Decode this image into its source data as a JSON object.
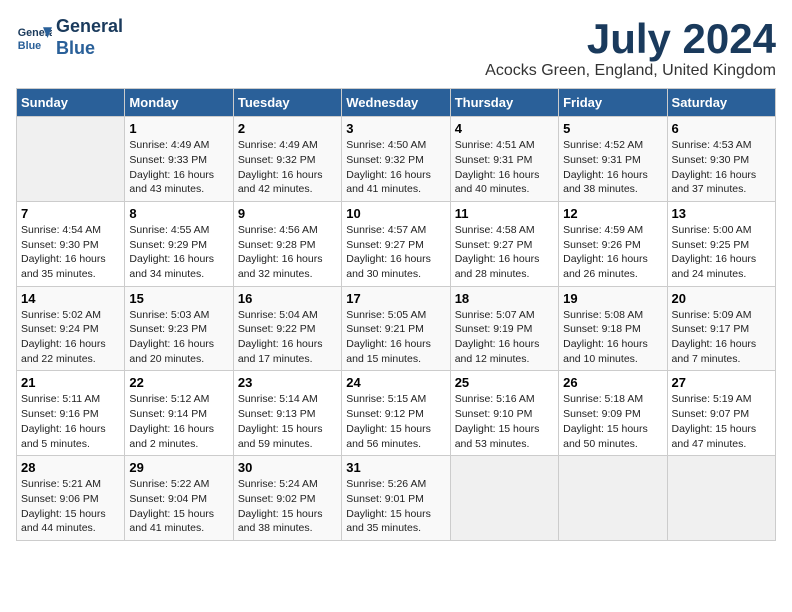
{
  "logo": {
    "line1": "General",
    "line2": "Blue"
  },
  "title": "July 2024",
  "subtitle": "Acocks Green, England, United Kingdom",
  "days_of_week": [
    "Sunday",
    "Monday",
    "Tuesday",
    "Wednesday",
    "Thursday",
    "Friday",
    "Saturday"
  ],
  "weeks": [
    [
      {
        "num": "",
        "info": ""
      },
      {
        "num": "1",
        "info": "Sunrise: 4:49 AM\nSunset: 9:33 PM\nDaylight: 16 hours\nand 43 minutes."
      },
      {
        "num": "2",
        "info": "Sunrise: 4:49 AM\nSunset: 9:32 PM\nDaylight: 16 hours\nand 42 minutes."
      },
      {
        "num": "3",
        "info": "Sunrise: 4:50 AM\nSunset: 9:32 PM\nDaylight: 16 hours\nand 41 minutes."
      },
      {
        "num": "4",
        "info": "Sunrise: 4:51 AM\nSunset: 9:31 PM\nDaylight: 16 hours\nand 40 minutes."
      },
      {
        "num": "5",
        "info": "Sunrise: 4:52 AM\nSunset: 9:31 PM\nDaylight: 16 hours\nand 38 minutes."
      },
      {
        "num": "6",
        "info": "Sunrise: 4:53 AM\nSunset: 9:30 PM\nDaylight: 16 hours\nand 37 minutes."
      }
    ],
    [
      {
        "num": "7",
        "info": "Sunrise: 4:54 AM\nSunset: 9:30 PM\nDaylight: 16 hours\nand 35 minutes."
      },
      {
        "num": "8",
        "info": "Sunrise: 4:55 AM\nSunset: 9:29 PM\nDaylight: 16 hours\nand 34 minutes."
      },
      {
        "num": "9",
        "info": "Sunrise: 4:56 AM\nSunset: 9:28 PM\nDaylight: 16 hours\nand 32 minutes."
      },
      {
        "num": "10",
        "info": "Sunrise: 4:57 AM\nSunset: 9:27 PM\nDaylight: 16 hours\nand 30 minutes."
      },
      {
        "num": "11",
        "info": "Sunrise: 4:58 AM\nSunset: 9:27 PM\nDaylight: 16 hours\nand 28 minutes."
      },
      {
        "num": "12",
        "info": "Sunrise: 4:59 AM\nSunset: 9:26 PM\nDaylight: 16 hours\nand 26 minutes."
      },
      {
        "num": "13",
        "info": "Sunrise: 5:00 AM\nSunset: 9:25 PM\nDaylight: 16 hours\nand 24 minutes."
      }
    ],
    [
      {
        "num": "14",
        "info": "Sunrise: 5:02 AM\nSunset: 9:24 PM\nDaylight: 16 hours\nand 22 minutes."
      },
      {
        "num": "15",
        "info": "Sunrise: 5:03 AM\nSunset: 9:23 PM\nDaylight: 16 hours\nand 20 minutes."
      },
      {
        "num": "16",
        "info": "Sunrise: 5:04 AM\nSunset: 9:22 PM\nDaylight: 16 hours\nand 17 minutes."
      },
      {
        "num": "17",
        "info": "Sunrise: 5:05 AM\nSunset: 9:21 PM\nDaylight: 16 hours\nand 15 minutes."
      },
      {
        "num": "18",
        "info": "Sunrise: 5:07 AM\nSunset: 9:19 PM\nDaylight: 16 hours\nand 12 minutes."
      },
      {
        "num": "19",
        "info": "Sunrise: 5:08 AM\nSunset: 9:18 PM\nDaylight: 16 hours\nand 10 minutes."
      },
      {
        "num": "20",
        "info": "Sunrise: 5:09 AM\nSunset: 9:17 PM\nDaylight: 16 hours\nand 7 minutes."
      }
    ],
    [
      {
        "num": "21",
        "info": "Sunrise: 5:11 AM\nSunset: 9:16 PM\nDaylight: 16 hours\nand 5 minutes."
      },
      {
        "num": "22",
        "info": "Sunrise: 5:12 AM\nSunset: 9:14 PM\nDaylight: 16 hours\nand 2 minutes."
      },
      {
        "num": "23",
        "info": "Sunrise: 5:14 AM\nSunset: 9:13 PM\nDaylight: 15 hours\nand 59 minutes."
      },
      {
        "num": "24",
        "info": "Sunrise: 5:15 AM\nSunset: 9:12 PM\nDaylight: 15 hours\nand 56 minutes."
      },
      {
        "num": "25",
        "info": "Sunrise: 5:16 AM\nSunset: 9:10 PM\nDaylight: 15 hours\nand 53 minutes."
      },
      {
        "num": "26",
        "info": "Sunrise: 5:18 AM\nSunset: 9:09 PM\nDaylight: 15 hours\nand 50 minutes."
      },
      {
        "num": "27",
        "info": "Sunrise: 5:19 AM\nSunset: 9:07 PM\nDaylight: 15 hours\nand 47 minutes."
      }
    ],
    [
      {
        "num": "28",
        "info": "Sunrise: 5:21 AM\nSunset: 9:06 PM\nDaylight: 15 hours\nand 44 minutes."
      },
      {
        "num": "29",
        "info": "Sunrise: 5:22 AM\nSunset: 9:04 PM\nDaylight: 15 hours\nand 41 minutes."
      },
      {
        "num": "30",
        "info": "Sunrise: 5:24 AM\nSunset: 9:02 PM\nDaylight: 15 hours\nand 38 minutes."
      },
      {
        "num": "31",
        "info": "Sunrise: 5:26 AM\nSunset: 9:01 PM\nDaylight: 15 hours\nand 35 minutes."
      },
      {
        "num": "",
        "info": ""
      },
      {
        "num": "",
        "info": ""
      },
      {
        "num": "",
        "info": ""
      }
    ]
  ]
}
